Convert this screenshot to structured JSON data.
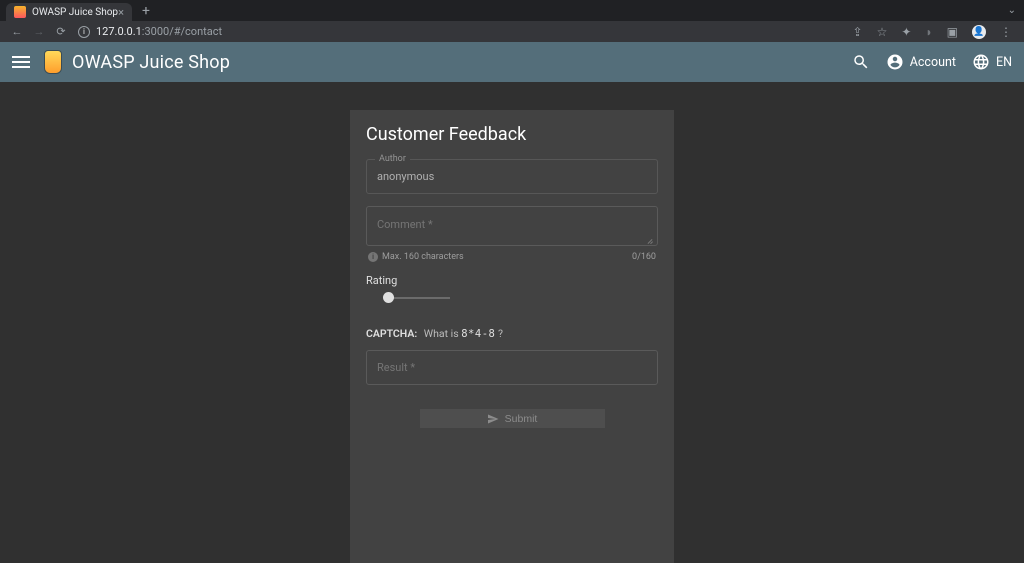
{
  "browser": {
    "tab_title": "OWASP Juice Shop",
    "url_host": "127.0.0.1",
    "url_port_path": ":3000/#/contact"
  },
  "appbar": {
    "title": "OWASP Juice Shop",
    "account_label": "Account",
    "lang_label": "EN"
  },
  "form": {
    "title": "Customer Feedback",
    "author_label": "Author",
    "author_value": "anonymous",
    "comment_placeholder": "Comment *",
    "hint_text": "Max. 160 characters",
    "char_counter": "0/160",
    "rating_label": "Rating",
    "captcha_label": "CAPTCHA:",
    "captcha_prompt": "What is",
    "captcha_expression": "8*4-8",
    "captcha_suffix": "?",
    "result_placeholder": "Result *",
    "submit_label": "Submit"
  }
}
